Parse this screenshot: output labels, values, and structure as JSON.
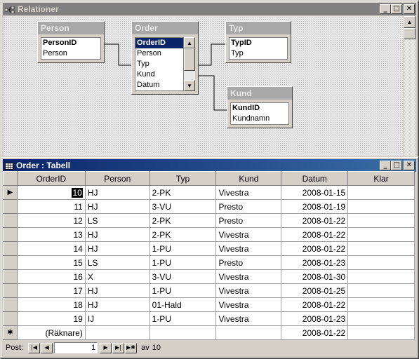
{
  "relations_window": {
    "title": "Relationer",
    "buttons": {
      "minimize": "_",
      "maximize": "□",
      "close": "✕"
    }
  },
  "tables": {
    "person": {
      "title": "Person",
      "fields": [
        "PersonID",
        "Person"
      ]
    },
    "order": {
      "title": "Order",
      "fields": [
        "OrderID",
        "Person",
        "Typ",
        "Kund",
        "Datum"
      ]
    },
    "typ": {
      "title": "Typ",
      "fields": [
        "TypID",
        "Typ"
      ]
    },
    "kund": {
      "title": "Kund",
      "fields": [
        "KundID",
        "Kundnamn"
      ]
    }
  },
  "datasheet": {
    "title": "Order : Tabell",
    "buttons": {
      "minimize": "_",
      "maximize": "□",
      "close": "✕"
    },
    "columns": [
      "OrderID",
      "Person",
      "Typ",
      "Kund",
      "Datum",
      "Klar"
    ],
    "rows": [
      {
        "orderid": "10",
        "person": "HJ",
        "typ": "2-PK",
        "kund": "Vivestra",
        "datum": "2008-01-15",
        "klar": ""
      },
      {
        "orderid": "11",
        "person": "HJ",
        "typ": "3-VU",
        "kund": "Presto",
        "datum": "2008-01-19",
        "klar": ""
      },
      {
        "orderid": "12",
        "person": "LS",
        "typ": "2-PK",
        "kund": "Presto",
        "datum": "2008-01-22",
        "klar": ""
      },
      {
        "orderid": "13",
        "person": "HJ",
        "typ": "2-PK",
        "kund": "Vivestra",
        "datum": "2008-01-22",
        "klar": ""
      },
      {
        "orderid": "14",
        "person": "HJ",
        "typ": "1-PU",
        "kund": "Vivestra",
        "datum": "2008-01-22",
        "klar": ""
      },
      {
        "orderid": "15",
        "person": "LS",
        "typ": "1-PU",
        "kund": "Presto",
        "datum": "2008-01-23",
        "klar": ""
      },
      {
        "orderid": "16",
        "person": "X",
        "typ": "3-VU",
        "kund": "Vivestra",
        "datum": "2008-01-30",
        "klar": ""
      },
      {
        "orderid": "17",
        "person": "HJ",
        "typ": "1-PU",
        "kund": "Vivestra",
        "datum": "2008-01-25",
        "klar": ""
      },
      {
        "orderid": "18",
        "person": "HJ",
        "typ": "01-Hald",
        "kund": "Vivestra",
        "datum": "2008-01-22",
        "klar": ""
      },
      {
        "orderid": "19",
        "person": "IJ",
        "typ": "1-PU",
        "kund": "Vivestra",
        "datum": "2008-01-23",
        "klar": ""
      }
    ],
    "new_row": {
      "marker": "✱",
      "orderid": "(Räknare)",
      "datum": "2008-01-22"
    },
    "current_row_marker": "▶"
  },
  "navigation": {
    "label": "Post:",
    "current": "1",
    "of_label": "av",
    "total": "10",
    "buttons": {
      "first": "|◀",
      "prev": "◀",
      "next": "▶",
      "last": "▶|",
      "new": "▶✱"
    }
  }
}
